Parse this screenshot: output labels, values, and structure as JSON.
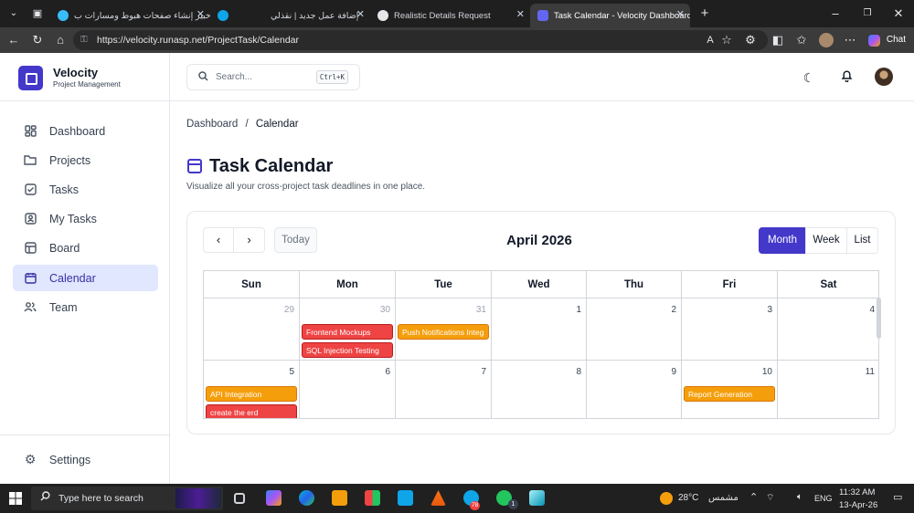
{
  "browser": {
    "tabs": [
      {
        "label": "خبير إنشاء صفحات هبوط ومسارات ب",
        "active": false
      },
      {
        "label": "إضافة عمل جديد | نقذلي",
        "active": false
      },
      {
        "label": "Realistic Details Request",
        "active": false
      },
      {
        "label": "Task Calendar - Velocity Dashboard",
        "active": true
      }
    ],
    "url": "https://velocity.runasp.net/ProjectTask/Calendar",
    "chat_label": "Chat"
  },
  "brand": {
    "name": "Velocity",
    "subtitle": "Project Management"
  },
  "sidebar": {
    "items": [
      {
        "label": "Dashboard",
        "icon": "dashboard-grid-icon",
        "active": false
      },
      {
        "label": "Projects",
        "icon": "folder-icon",
        "active": false
      },
      {
        "label": "Tasks",
        "icon": "checkbox-icon",
        "active": false
      },
      {
        "label": "My Tasks",
        "icon": "user-checklist-icon",
        "active": false
      },
      {
        "label": "Board",
        "icon": "kanban-icon",
        "active": false
      },
      {
        "label": "Calendar",
        "icon": "calendar-icon",
        "active": true
      },
      {
        "label": "Team",
        "icon": "users-icon",
        "active": false
      }
    ],
    "settings_label": "Settings"
  },
  "header": {
    "search_placeholder": "Search...",
    "search_shortcut": "Ctrl+K"
  },
  "breadcrumb": {
    "root": "Dashboard",
    "separator": "/",
    "current": "Calendar"
  },
  "page": {
    "title": "Task Calendar",
    "subtitle": "Visualize all your cross-project task deadlines in one place."
  },
  "calendar": {
    "today_label": "Today",
    "month_title": "April 2026",
    "views": [
      {
        "label": "Month",
        "active": true
      },
      {
        "label": "Week",
        "active": false
      },
      {
        "label": "List",
        "active": false
      }
    ],
    "day_headers": [
      "Sun",
      "Mon",
      "Tue",
      "Wed",
      "Thu",
      "Fri",
      "Sat"
    ],
    "weeks": [
      [
        {
          "day": "29",
          "other": true,
          "events": []
        },
        {
          "day": "30",
          "other": true,
          "events": [
            {
              "title": "Frontend Mockups",
              "color": "red"
            },
            {
              "title": "SQL Injection Testing",
              "color": "red"
            }
          ]
        },
        {
          "day": "31",
          "other": true,
          "events": [
            {
              "title": "Push Notifications Integ",
              "color": "orange"
            }
          ]
        },
        {
          "day": "1",
          "other": false,
          "events": []
        },
        {
          "day": "2",
          "other": false,
          "events": []
        },
        {
          "day": "3",
          "other": false,
          "events": []
        },
        {
          "day": "4",
          "other": false,
          "events": []
        }
      ],
      [
        {
          "day": "5",
          "other": false,
          "events": [
            {
              "title": "API Integration",
              "color": "orange"
            },
            {
              "title": "create the erd",
              "color": "red"
            }
          ]
        },
        {
          "day": "6",
          "other": false,
          "events": []
        },
        {
          "day": "7",
          "other": false,
          "events": []
        },
        {
          "day": "8",
          "other": false,
          "events": []
        },
        {
          "day": "9",
          "other": false,
          "events": []
        },
        {
          "day": "10",
          "other": false,
          "events": [
            {
              "title": "Report Generation",
              "color": "orange"
            }
          ]
        },
        {
          "day": "11",
          "other": false,
          "events": []
        }
      ]
    ],
    "colors": {
      "red": "#ef4444",
      "orange": "#f59e0b",
      "accent": "#4338ca"
    }
  },
  "taskbar": {
    "search_placeholder": "Type here to search",
    "temperature": "28°C",
    "weather_text": "مشمس",
    "language": "ENG",
    "time": "11:32 AM",
    "date": "13-Apr-26",
    "telegram_badge": "78",
    "whatsapp_badge": "1"
  }
}
